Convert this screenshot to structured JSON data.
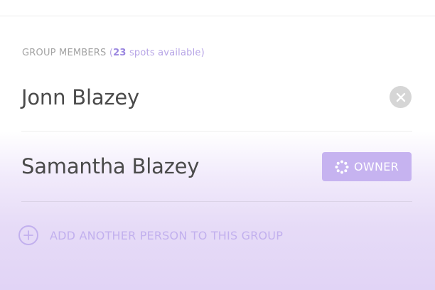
{
  "section": {
    "header_label": "GROUP MEMBERS",
    "open_paren": "(",
    "spots_count": "23",
    "spots_text": " spots available)"
  },
  "members": [
    {
      "name": "Jonn Blazey",
      "action_icon": "close-icon"
    },
    {
      "name": "Samantha Blazey",
      "badge_icon": "owner-dots-icon",
      "badge_label": "OWNER"
    }
  ],
  "add_person": {
    "icon": "plus-circle-icon",
    "label": "ADD ANOTHER PERSON TO THIS GROUP"
  },
  "colors": {
    "accent": "#c6b3f0",
    "accent_text": "#9a86e0",
    "text_primary": "#4a4a4a",
    "text_muted": "#a3a3a3"
  }
}
